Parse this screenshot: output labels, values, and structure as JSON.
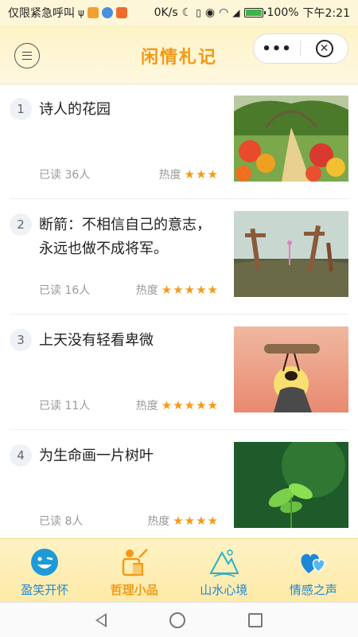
{
  "status_bar": {
    "carrier": "仅限紧急呼叫",
    "speed": "0K/s",
    "battery": "100%",
    "time": "下午2:21",
    "icons": [
      "usb-icon",
      "app-icon",
      "music-icon",
      "video-icon",
      "moon-icon",
      "vibrate-icon",
      "eye-icon",
      "wifi-icon",
      "signal-icon",
      "battery-icon"
    ]
  },
  "header": {
    "title": "闲情札记",
    "more_label": "•••",
    "close_label": "✕"
  },
  "articles": [
    {
      "num": "1",
      "title": "诗人的花园",
      "read": "已读 36人",
      "heat_label": "热度",
      "stars": "★★★",
      "rating": 3,
      "image": "garden-image"
    },
    {
      "num": "2",
      "title": "断箭：不相信自己的意志，永远也做不成将军。",
      "read": "已读 16人",
      "heat_label": "热度",
      "stars": "★★★★★",
      "rating": 5,
      "image": "arrows-image"
    },
    {
      "num": "3",
      "title": "上天没有轻看卑微",
      "read": "已读 11人",
      "heat_label": "热度",
      "stars": "★★★★★",
      "rating": 5,
      "image": "ant-image"
    },
    {
      "num": "4",
      "title": "为生命画一片树叶",
      "read": "已读 8人",
      "heat_label": "热度",
      "stars": "★★★★",
      "rating": 4,
      "image": "leaves-image"
    }
  ],
  "tabs": [
    {
      "label": "盈笑开怀",
      "icon": "smile-icon",
      "active": false
    },
    {
      "label": "哲理小品",
      "icon": "reading-icon",
      "active": true
    },
    {
      "label": "山水心境",
      "icon": "mountain-icon",
      "active": false
    },
    {
      "label": "情感之声",
      "icon": "hearts-icon",
      "active": false
    }
  ],
  "colors": {
    "accent": "#f39a16",
    "tab_blue": "#1e88d8",
    "header_bg": "#fdf3c6"
  }
}
